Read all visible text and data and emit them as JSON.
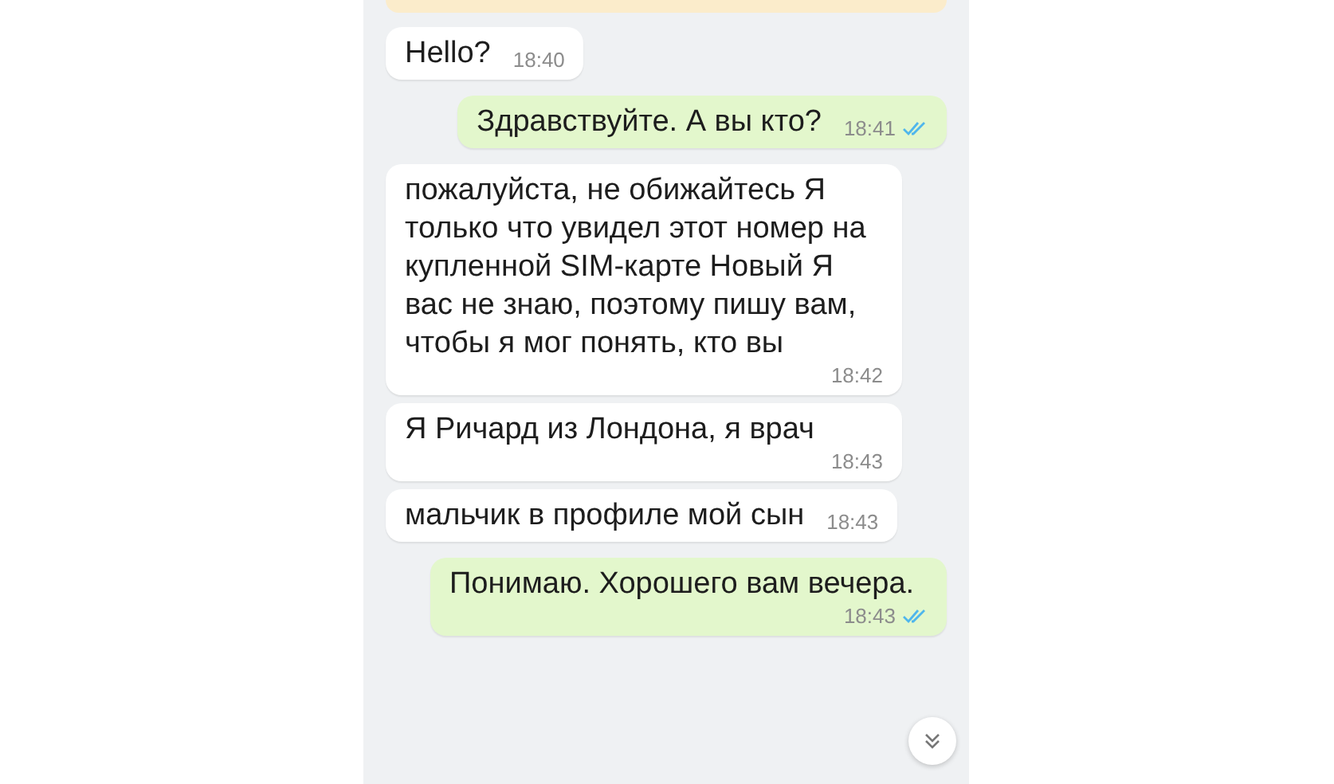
{
  "messages": [
    {
      "kind": "incoming",
      "text": "Hello?",
      "time": "18:40"
    },
    {
      "kind": "outgoing",
      "text": "Здравствуйте. А вы кто?",
      "time": "18:41",
      "read": true
    },
    {
      "kind": "incoming",
      "text": "пожалуйста, не обижайтесь Я только что увидел этот номер на купленной SIM-карте Новый Я вас не знаю, поэтому пишу вам, чтобы я мог понять, кто вы",
      "time": "18:42"
    },
    {
      "kind": "incoming",
      "text": "Я Ричард из Лондона, я врач",
      "time": "18:43"
    },
    {
      "kind": "incoming",
      "text": "мальчик в профиле мой сын",
      "time": "18:43"
    },
    {
      "kind": "outgoing",
      "text": "Понимаю. Хорошего вам вечера.",
      "time": "18:43",
      "read": true
    }
  ]
}
